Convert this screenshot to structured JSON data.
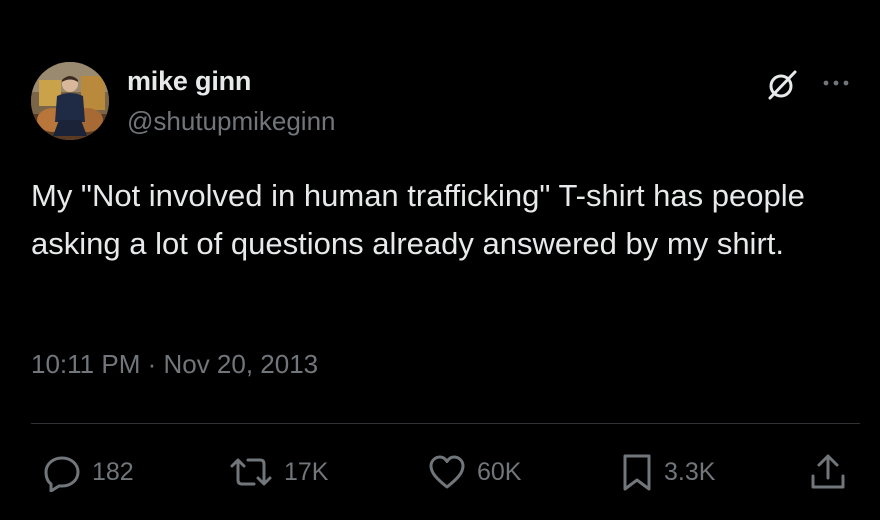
{
  "author": {
    "display_name": "mike ginn",
    "handle": "@shutupmikeginn"
  },
  "tweet": {
    "text": "My \"Not involved in human trafficking\" T-shirt has people asking a lot of questions already answered by my shirt.",
    "timestamp": "10:11 PM · Nov 20, 2013"
  },
  "actions": {
    "replies": "182",
    "retweets": "17K",
    "likes": "60K",
    "bookmarks": "3.3K"
  },
  "icons": {
    "header": [
      "grok-icon",
      "more-icon"
    ],
    "actions": [
      "reply-icon",
      "retweet-icon",
      "like-icon",
      "bookmark-icon",
      "share-icon"
    ]
  },
  "colors": {
    "background": "#000000",
    "primary_text": "#e7e9ea",
    "secondary_text": "#71767b",
    "divider": "#2f3336"
  }
}
